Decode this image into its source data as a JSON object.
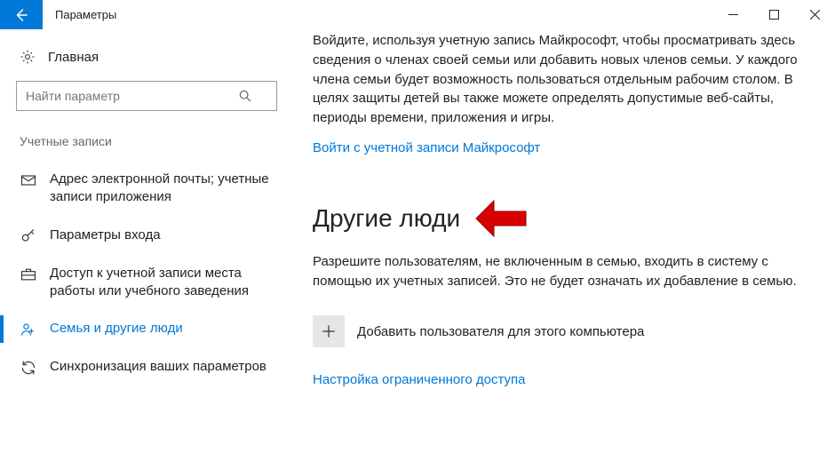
{
  "titlebar": {
    "title": "Параметры"
  },
  "sidebar": {
    "home": "Главная",
    "search_placeholder": "Найти параметр",
    "section": "Учетные записи",
    "items": [
      {
        "label": "Адрес электронной почты; учетные записи приложения"
      },
      {
        "label": "Параметры входа"
      },
      {
        "label": "Доступ к учетной записи места работы или учебного заведения"
      },
      {
        "label": "Семья и другие люди"
      },
      {
        "label": "Синхронизация ваших параметров"
      }
    ]
  },
  "content": {
    "intro": "Войдите, используя учетную запись Майкрософт, чтобы просматривать здесь сведения о членах своей семьи или добавить новых членов семьи. У каждого члена семьи будет возможность пользоваться отдельным рабочим столом. В целях защиты детей вы также можете определять допустимые веб-сайты, периоды времени, приложения и игры.",
    "signin_link": "Войти с учетной записи Майкрософт",
    "section_title": "Другие люди",
    "others_desc": "Разрешите пользователям, не включенным в семью, входить в систему с помощью их учетных записей. Это не будет означать их добавление в семью.",
    "add_label": "Добавить пользователя для этого компьютера",
    "restricted_link": "Настройка ограниченного доступа"
  }
}
